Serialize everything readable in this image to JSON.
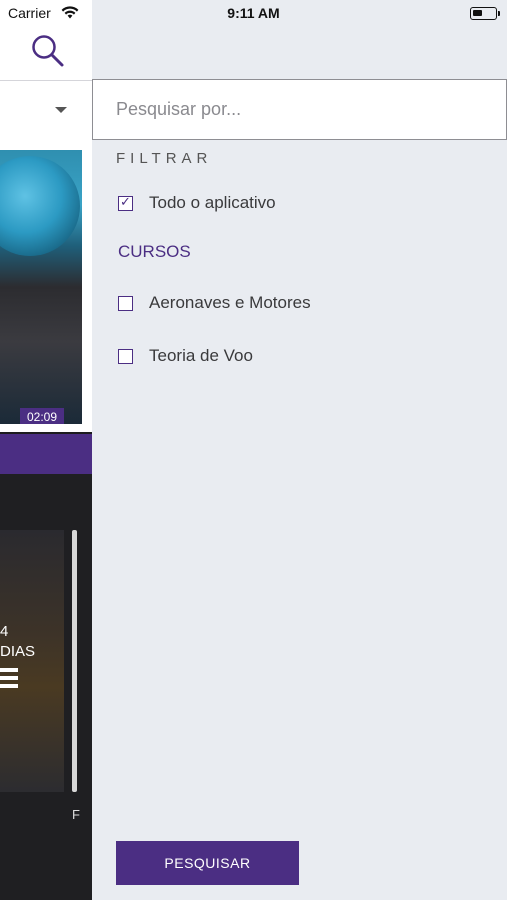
{
  "status_bar": {
    "carrier": "Carrier",
    "time": "9:11 AM",
    "icons": [
      "wifi-icon",
      "battery-icon"
    ]
  },
  "background_app": {
    "video_duration": "02:09",
    "thumbnail_text": "4\nDIAS",
    "partial_letter": "F"
  },
  "search_panel": {
    "search_placeholder": "Pesquisar por...",
    "search_value": "",
    "filter_title": "FILTRAR",
    "options": [
      {
        "label": "Todo o aplicativo",
        "checked": true
      }
    ],
    "courses_title": "CURSOS",
    "courses": [
      {
        "label": "Aeronaves e Motores",
        "checked": false
      },
      {
        "label": "Teoria de Voo",
        "checked": false
      }
    ],
    "submit_label": "PESQUISAR"
  },
  "colors": {
    "accent": "#4b2e83",
    "panel_bg": "#e9ecf1"
  }
}
